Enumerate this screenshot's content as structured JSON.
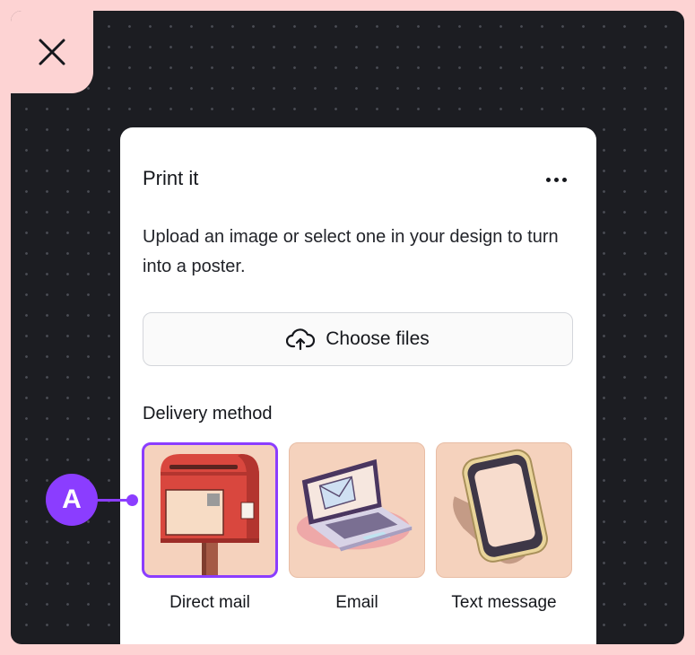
{
  "panel": {
    "title": "Print it",
    "description": "Upload an image or select one in your design to turn into a poster.",
    "choose_files_label": "Choose files",
    "delivery_label": "Delivery method",
    "options": [
      {
        "label": "Direct mail",
        "icon": "mailbox-icon",
        "selected": true
      },
      {
        "label": "Email",
        "icon": "laptop-email-icon",
        "selected": false
      },
      {
        "label": "Text message",
        "icon": "phone-icon",
        "selected": false
      }
    ]
  },
  "annotation": {
    "badge": "A"
  },
  "colors": {
    "accent": "#8b3dff",
    "background": "#fdd3d3",
    "canvas": "#1c1d22",
    "tile": "#f5d2bd"
  }
}
